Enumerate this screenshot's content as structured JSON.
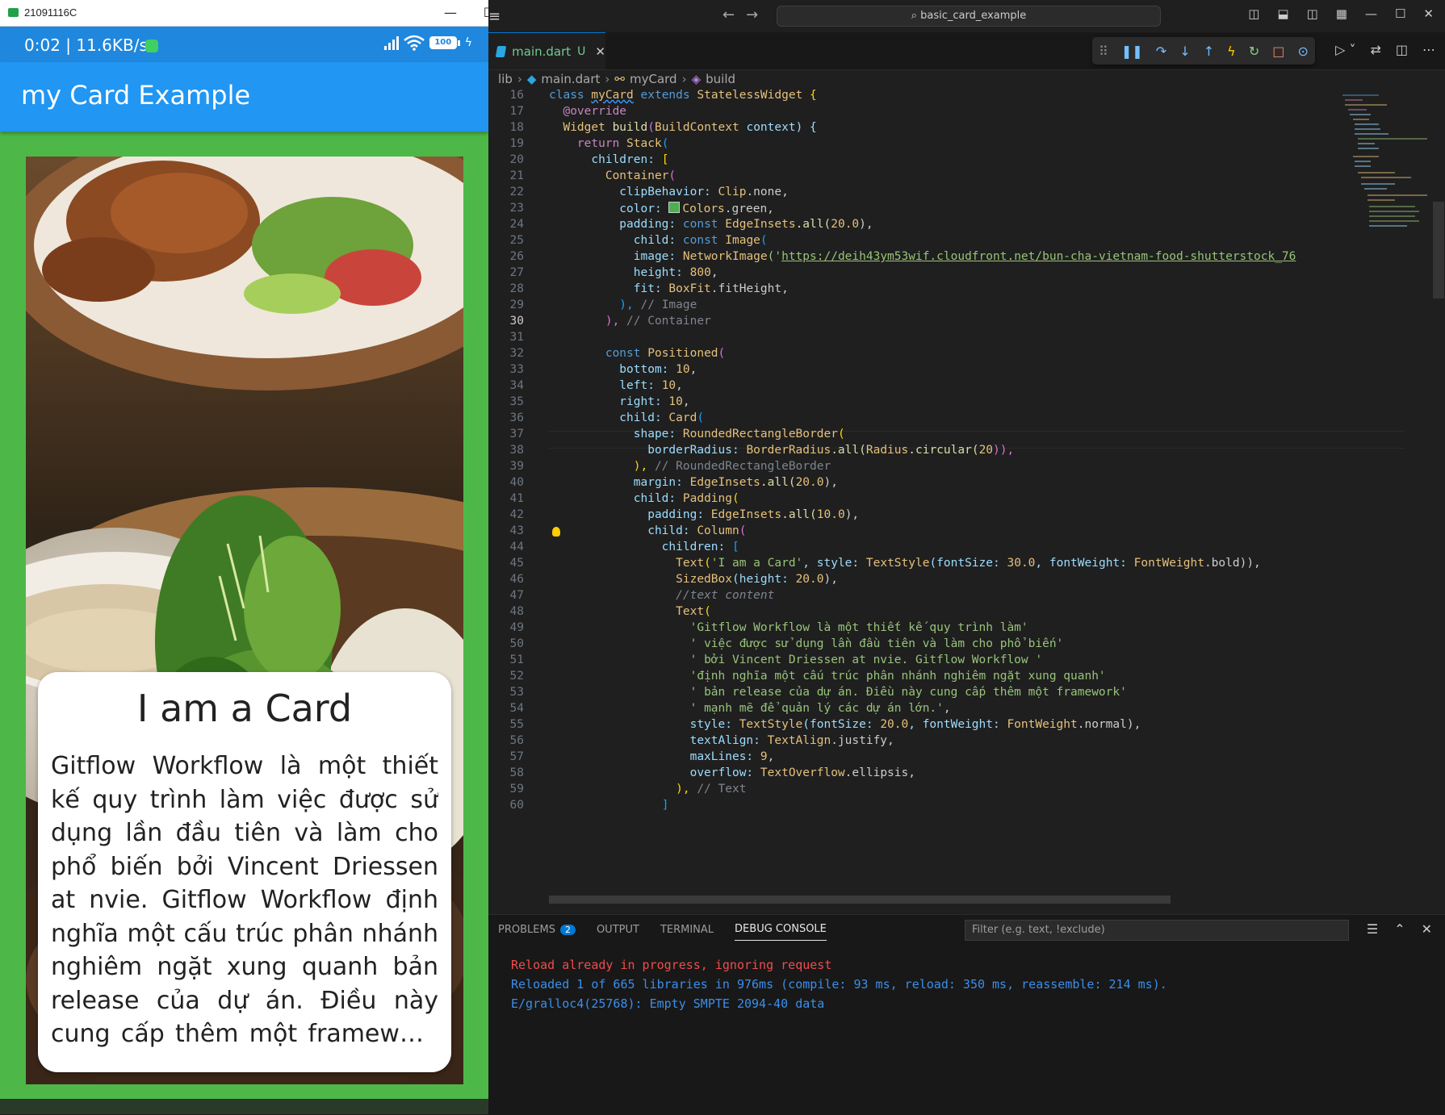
{
  "phone_window": {
    "title": "21091116C",
    "controls": [
      "—",
      "☐",
      "✕"
    ],
    "status_text": "0:02 | 11.6KB/s",
    "battery": "100",
    "app_title": "my Card Example",
    "card_title": "I am a Card",
    "card_body": "Gitflow Workflow là một thiết kế quy trình làm việc được sử dụng lần đầu tiên và làm cho phổ biến bởi Vincent Driessen at nvie. Gitflow Workflow định nghĩa một cấu trúc phân nhánh nghiêm ngặt xung quanh bản release của dự án. Điều này cung cấp thêm một framework mạnh mẽ để quản lý các dự án lớn."
  },
  "vscode": {
    "menu_icon": "≡",
    "search": "basic_card_example",
    "tab": {
      "name": "main.dart",
      "badge": "U",
      "close": "✕"
    },
    "breadcrumb": [
      "lib",
      "main.dart",
      "myCard",
      "build"
    ],
    "colors": {
      "background": "#1f1f1f",
      "keyword": "#c586c0",
      "type": "#e5c07b",
      "string": "#98c379",
      "accent": "#0078d4"
    },
    "panel": {
      "tabs": [
        "PROBLEMS",
        "OUTPUT",
        "TERMINAL",
        "DEBUG CONSOLE"
      ],
      "problems_count": "2",
      "active_tab": "DEBUG CONSOLE",
      "filter_placeholder": "Filter (e.g. text, !exclude)",
      "console_lines": [
        "Reload already in progress, ignoring request",
        "Reloaded 1 of 665 libraries in 976ms (compile: 93 ms, reload: 350 ms, reassemble: 214 ms).",
        "E/gralloc4(25768): Empty SMPTE 2094-40 data"
      ]
    },
    "line_numbers": [
      "16",
      "17",
      "18",
      "19",
      "20",
      "21",
      "22",
      "23",
      "24",
      "25",
      "26",
      "27",
      "28",
      "29",
      "30",
      "31",
      "32",
      "33",
      "34",
      "35",
      "36",
      "37",
      "38",
      "39",
      "40",
      "41",
      "42",
      "43",
      "44",
      "45",
      "46",
      "47",
      "48",
      "49",
      "50",
      "51",
      "52",
      "53",
      "54",
      "55",
      "56",
      "57",
      "58",
      "59",
      "60"
    ],
    "active_line": "30",
    "code": {
      "l16": {
        "a": "class ",
        "b": "myCard",
        "c": " extends ",
        "d": "StatelessWidget",
        "e": " {"
      },
      "l17": {
        "a": "  @override"
      },
      "l18": {
        "a": "  Widget ",
        "b": "build",
        "c": "(",
        "d": "BuildContext",
        "e": " context) {"
      },
      "l19": {
        "a": "    return ",
        "b": "Stack",
        "c": "("
      },
      "l20": {
        "a": "      children: ",
        "b": "["
      },
      "l21": {
        "a": "        ",
        "b": "Container",
        "c": "("
      },
      "l22": {
        "a": "          clipBehavior: ",
        "b": "Clip",
        "c": ".none,"
      },
      "l23": {
        "a": "          color: ",
        "b": "Colors",
        "c": ".green,"
      },
      "l24": {
        "a": "          padding: ",
        "b": "const ",
        "c": "EdgeInsets",
        "d": ".all(",
        "e": "20.0",
        "f": "),"
      },
      "l25": {
        "a": "            child: ",
        "b": "const ",
        "c": "Image",
        "d": "("
      },
      "l26": {
        "a": "            image: ",
        "b": "NetworkImage",
        "c": "('",
        "d": "https://deih43ym53wif.cloudfront.net/bun-cha-vietnam-food-shutterstock_76"
      },
      "l27": {
        "a": "            height: ",
        "b": "800",
        "c": ","
      },
      "l28": {
        "a": "            fit: ",
        "b": "BoxFit",
        "c": ".fitHeight,"
      },
      "l29": {
        "a": "          ), ",
        "b": "// Image"
      },
      "l30": {
        "a": "        ), ",
        "b": "// Container"
      },
      "l31": {
        "a": ""
      },
      "l32": {
        "a": "        ",
        "b": "const ",
        "c": "Positioned",
        "d": "("
      },
      "l33": {
        "a": "          bottom: ",
        "b": "10",
        "c": ","
      },
      "l34": {
        "a": "          left: ",
        "b": "10",
        "c": ","
      },
      "l35": {
        "a": "          right: ",
        "b": "10",
        "c": ","
      },
      "l36": {
        "a": "          child: ",
        "b": "Card",
        "c": "("
      },
      "l37": {
        "a": "            shape: ",
        "b": "RoundedRectangleBorder",
        "c": "("
      },
      "l38": {
        "a": "              borderRadius: ",
        "b": "BorderRadius",
        "c": ".all(",
        "d": "Radius",
        "e": ".circular(",
        "f": "20",
        "g": ")),"
      },
      "l39": {
        "a": "            ), ",
        "b": "// RoundedRectangleBorder"
      },
      "l40": {
        "a": "            margin: ",
        "b": "EdgeInsets",
        "c": ".all(",
        "d": "20.0",
        "e": "),"
      },
      "l41": {
        "a": "            child: ",
        "b": "Padding",
        "c": "("
      },
      "l42": {
        "a": "              padding: ",
        "b": "EdgeInsets",
        "c": ".all(",
        "d": "10.0",
        "e": "),"
      },
      "l43": {
        "a": "              child: ",
        "b": "Column",
        "c": "("
      },
      "l44": {
        "a": "                children: ",
        "b": "["
      },
      "l45": {
        "a": "                  ",
        "b": "Text",
        "c": "(",
        "d": "'I am a Card'",
        "e": ", style: ",
        "f": "TextStyle",
        "g": "(fontSize: ",
        "h": "30.0",
        "i": ", fontWeight: ",
        "j": "FontWeight",
        "k": ".bold)),"
      },
      "l46": {
        "a": "                  ",
        "b": "SizedBox",
        "c": "(height: ",
        "d": "20.0",
        "e": "),"
      },
      "l47": {
        "a": "                  ",
        "b": "//text content"
      },
      "l48": {
        "a": "                  ",
        "b": "Text",
        "c": "("
      },
      "l49": {
        "a": "                    ",
        "b": "'Gitflow Workflow là một thiết kế quy trình làm'"
      },
      "l50": {
        "a": "                    ",
        "b": "' việc được sử dụng lần đầu tiên và làm cho phổ biến'"
      },
      "l51": {
        "a": "                    ",
        "b": "' bởi Vincent Driessen at nvie. Gitflow Workflow '"
      },
      "l52": {
        "a": "                    ",
        "b": "'định nghĩa một cấu trúc phân nhánh nghiêm ngặt xung quanh'"
      },
      "l53": {
        "a": "                    ",
        "b": "' bản release của dự án. Điều này cung cấp thêm một framework'"
      },
      "l54": {
        "a": "                    ",
        "b": "' mạnh mẽ để quản lý các dự án lớn.'",
        "c": ","
      },
      "l55": {
        "a": "                    style: ",
        "b": "TextStyle",
        "c": "(fontSize: ",
        "d": "20.0",
        "e": ", fontWeight: ",
        "f": "FontWeight",
        "g": ".normal),"
      },
      "l56": {
        "a": "                    textAlign: ",
        "b": "TextAlign",
        "c": ".justify,"
      },
      "l57": {
        "a": "                    maxLines: ",
        "b": "9",
        "c": ","
      },
      "l58": {
        "a": "                    overflow: ",
        "b": "TextOverflow",
        "c": ".ellipsis,"
      },
      "l59": {
        "a": "                  ), ",
        "b": "// Text"
      },
      "l60": {
        "a": "                ",
        "b": "]"
      }
    }
  }
}
